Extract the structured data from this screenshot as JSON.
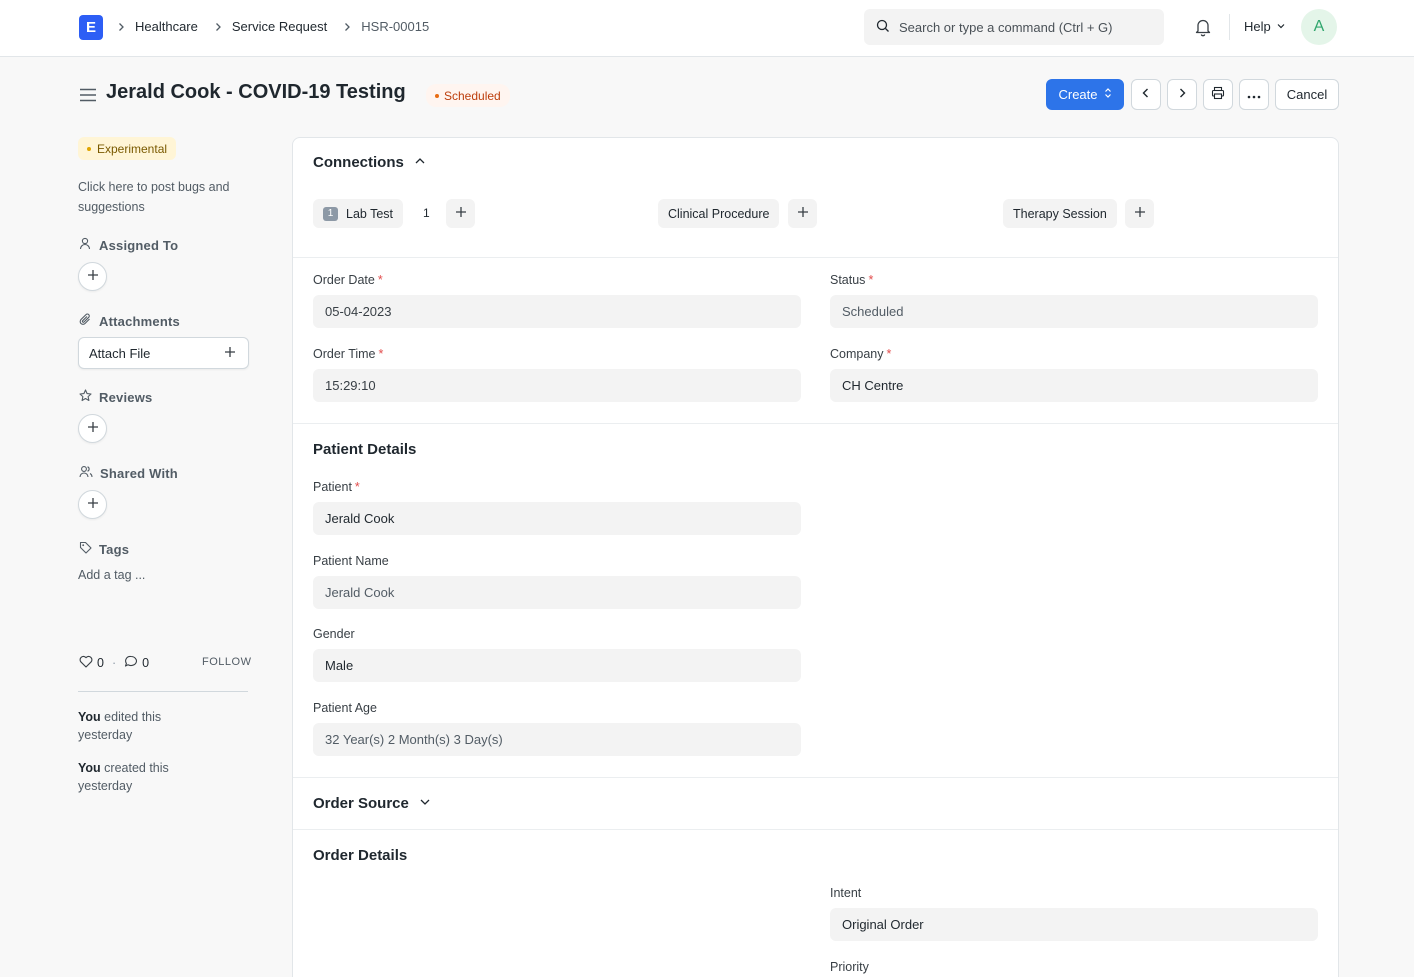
{
  "app": {
    "logo_letter": "E"
  },
  "breadcrumbs": [
    "Healthcare",
    "Service Request",
    "HSR-00015"
  ],
  "search": {
    "placeholder": "Search or type a command (Ctrl + G)"
  },
  "navbar": {
    "help_label": "Help",
    "avatar_initial": "A"
  },
  "page": {
    "title": "Jerald Cook - COVID-19 Testing",
    "status": "Scheduled"
  },
  "actions": {
    "create_label": "Create",
    "cancel_label": "Cancel"
  },
  "sidebar": {
    "experimental_label": "Experimental",
    "bug_text": "Click here to post bugs and suggestions",
    "assigned_to_label": "Assigned To",
    "attachments_label": "Attachments",
    "attach_file_label": "Attach File",
    "reviews_label": "Reviews",
    "shared_with_label": "Shared With",
    "tags_label": "Tags",
    "add_tag_label": "Add a tag ...",
    "likes_count": "0",
    "comments_count": "0",
    "follow_label": "FOLLOW",
    "activity": [
      {
        "actor": "You",
        "text": " edited this yesterday"
      },
      {
        "actor": "You",
        "text": " created this yesterday"
      }
    ]
  },
  "connections": {
    "title": "Connections",
    "items": [
      {
        "label": "Lab Test",
        "badge": "1",
        "count": "1"
      },
      {
        "label": "Clinical Procedure"
      },
      {
        "label": "Therapy Session"
      }
    ]
  },
  "fields": {
    "order_date": {
      "label": "Order Date",
      "value": "05-04-2023"
    },
    "status": {
      "label": "Status",
      "value": "Scheduled"
    },
    "order_time": {
      "label": "Order Time",
      "value": "15:29:10"
    },
    "company": {
      "label": "Company",
      "value": "CH Centre"
    }
  },
  "patient_details": {
    "title": "Patient Details",
    "patient": {
      "label": "Patient",
      "value": "Jerald Cook"
    },
    "patient_name": {
      "label": "Patient Name",
      "value": "Jerald Cook"
    },
    "gender": {
      "label": "Gender",
      "value": "Male"
    },
    "patient_age": {
      "label": "Patient Age",
      "value": "32 Year(s) 2 Month(s) 3 Day(s)"
    }
  },
  "order_source": {
    "title": "Order Source"
  },
  "order_details": {
    "title": "Order Details",
    "intent": {
      "label": "Intent",
      "value": "Original Order"
    },
    "priority": {
      "label": "Priority"
    }
  },
  "colors": {
    "primary": "#2d74e9",
    "logo": "#2d5ef5",
    "status_text": "#bd3e0c",
    "required": "#e24c4c"
  }
}
